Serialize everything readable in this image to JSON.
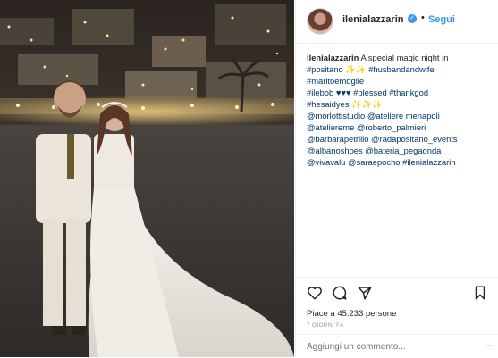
{
  "header": {
    "username": "ilenialazzarin",
    "separator": "•",
    "follow_label": "Segui"
  },
  "caption": {
    "username": "ilenialazzarin",
    "text": "A special magic night in",
    "line2_tags": "#positano ✨✨ #husbandandwife",
    "line3": "#maritoemoglie",
    "line4": "#ilebob ♥♥♥ #blessed #thankgod",
    "line5": "#hesaidyes ✨✨✨",
    "line6": "@morlottistudio @ateliere menapoli",
    "line7": "@ateliereme @roberto_palmieri",
    "line8": "@barbarapetrillo @radapositano_events",
    "line9": "@albanoshoes @bateria_pegaonda",
    "line10": "@vivavalu @saraepocho #ilenialazzarin"
  },
  "actions": {
    "likes_text": "Piace a 45.233 persone",
    "time_text": "7 GIORNI FA"
  },
  "comment": {
    "placeholder": "Aggiungi un commento...",
    "more": "..."
  },
  "colors": {
    "link": "#3897f0",
    "tag": "#003569",
    "text": "#262626",
    "muted": "#999999"
  }
}
